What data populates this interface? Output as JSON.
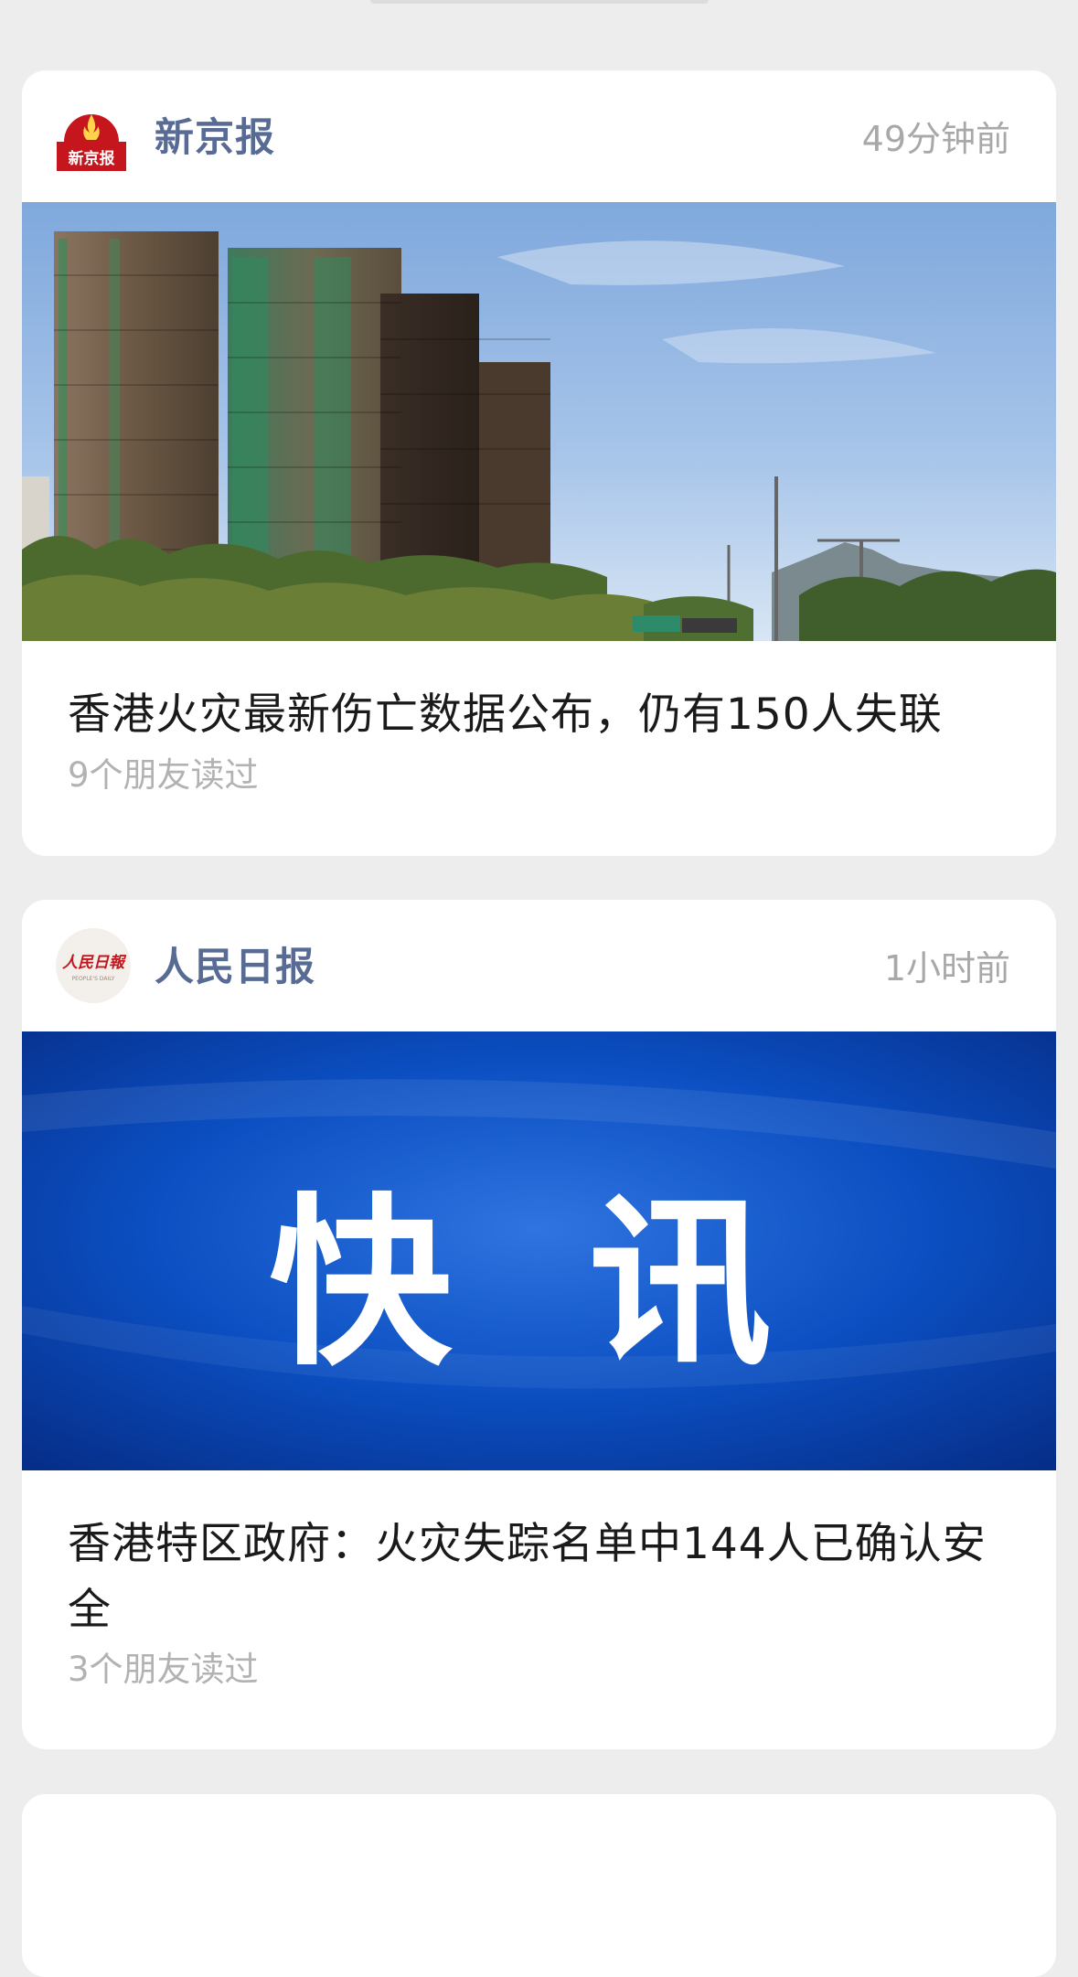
{
  "feed": {
    "articles": [
      {
        "source": "新京报",
        "time": "49分钟前",
        "title": "香港火灾最新伤亡数据公布，仍有150人失联",
        "read_count": "9个朋友读过",
        "logo_icon": "xinjingbao-logo-icon",
        "logo_text": "新京报"
      },
      {
        "source": "人民日报",
        "time": "1小时前",
        "title": "香港特区政府：火灾失踪名单中144人已确认安全",
        "read_count": "3个朋友读过",
        "logo_icon": "peoples-daily-logo-icon",
        "logo_text": "人民日報",
        "logo_subtext": "PEOPLE'S DAILY",
        "cover_text": "快 讯"
      }
    ]
  },
  "colors": {
    "background": "#ededed",
    "card": "#ffffff",
    "source_name": "#576b95",
    "meta_text": "#a8a8a8",
    "title_text": "#1a1a1a",
    "logo_red": "#c4161c",
    "flash_blue": "#0a3aa8"
  }
}
